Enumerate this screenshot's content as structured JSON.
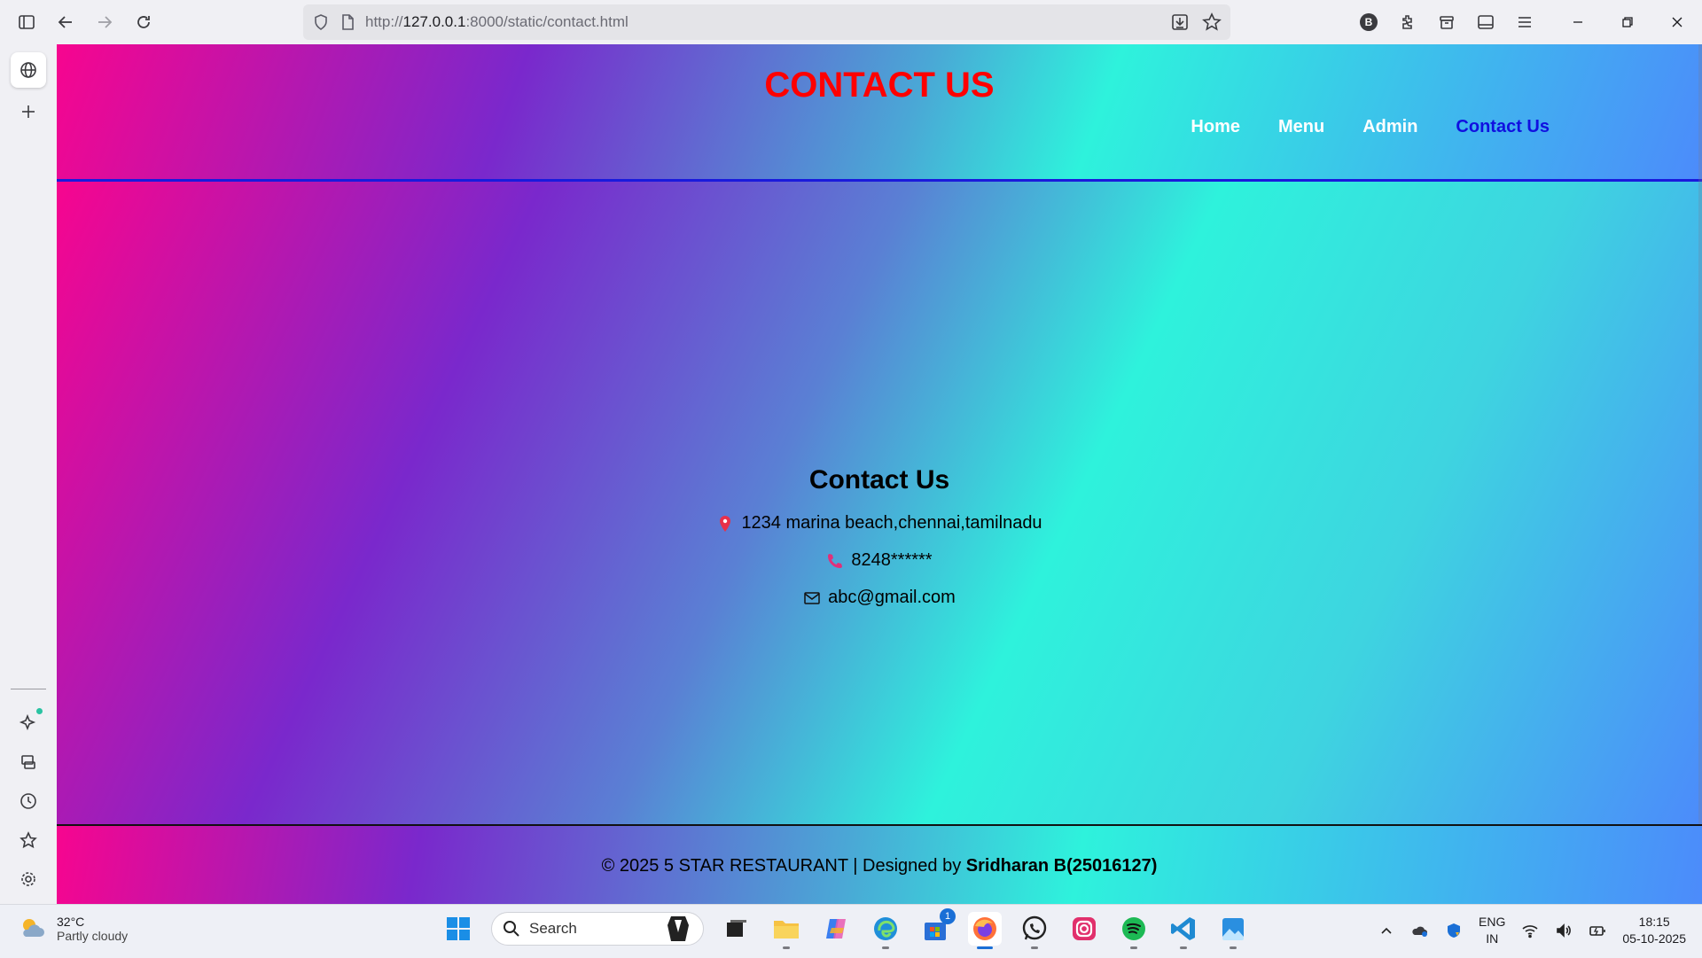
{
  "browser": {
    "url_scheme": "http://",
    "url_host": "127.0.0.1",
    "url_path": ":8000/static/contact.html",
    "profile_badge": "B"
  },
  "page": {
    "site_title": "CONTACT US",
    "nav": [
      {
        "label": "Home",
        "active": false
      },
      {
        "label": "Menu",
        "active": false
      },
      {
        "label": "Admin",
        "active": false
      },
      {
        "label": "Contact Us",
        "active": true
      }
    ],
    "contact": {
      "heading": "Contact Us",
      "address": "1234 marina beach,chennai,tamilnadu",
      "phone": "8248******",
      "email": "abc@gmail.com"
    },
    "footer": {
      "prefix": "© 2025 5 STAR RESTAURANT | Designed by ",
      "author": "Sridharan B(25016127)"
    }
  },
  "taskbar": {
    "weather_temp": "32°C",
    "weather_cond": "Partly cloudy",
    "search_label": "Search",
    "store_badge": "1",
    "lang_top": "ENG",
    "lang_bottom": "IN",
    "time": "18:15",
    "date": "05-10-2025"
  },
  "colors": {
    "title": "#ff0000",
    "nav_active": "#1010e0",
    "header_border": "#1a1adc"
  }
}
